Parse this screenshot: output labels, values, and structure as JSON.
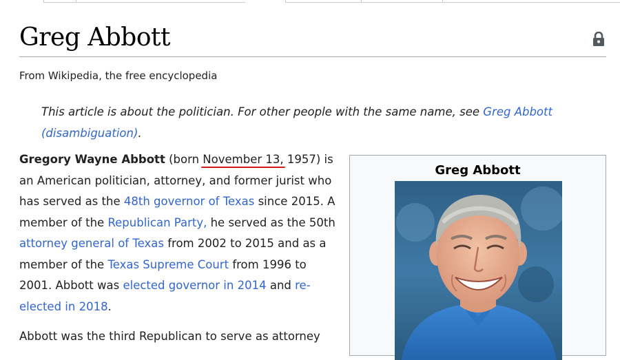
{
  "page": {
    "title": "Greg Abbott",
    "tagline": "From Wikipedia, the free encyclopedia"
  },
  "hatnote": {
    "text": "This article is about the politician. For other people with the same name, see ",
    "link": "Greg Abbott (disambiguation)",
    "end": "."
  },
  "lead": {
    "name": "Gregory Wayne Abbott",
    "t1": " (born ",
    "birthdate": "November 13,",
    "t2": " 1957) is an American politician, attorney, and former jurist who has served as the ",
    "link_governor": "48th governor of Texas",
    "t3": " since 2015. A member of the ",
    "link_party": "Republican Party,",
    "t4": " he served as the 50th ",
    "link_ag": "attorney general of Texas",
    "t5": " from 2002 to 2015 and as a member of the ",
    "link_court": "Texas Supreme Court",
    "t6": " from 1996 to 2001. Abbott was ",
    "link_elected": "elected governor in 2014",
    "t7": " and ",
    "link_reelected": "re-elected in 2018",
    "t8": "."
  },
  "lead2": {
    "text": "Abbott was the third Republican to serve as attorney"
  },
  "infobox": {
    "title": "Greg Abbott"
  },
  "colors": {
    "link": "#3366cc",
    "underline": "#d11b1b",
    "border": "#a2a9b1"
  },
  "icons": {
    "lock": "lock-icon"
  }
}
